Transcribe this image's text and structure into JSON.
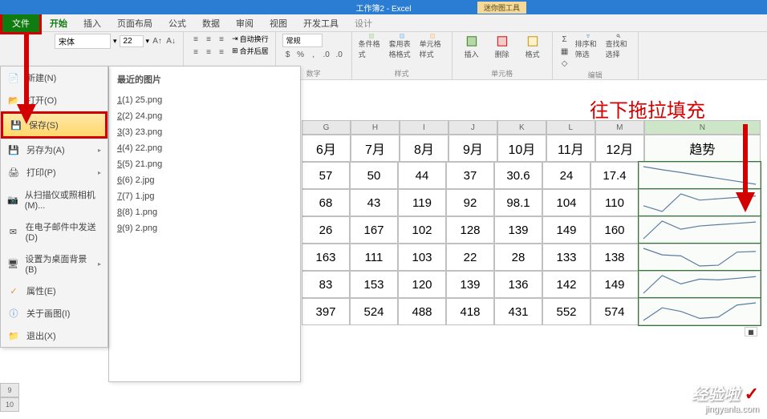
{
  "title": "工作簿2 - Excel",
  "mini_tool": "迷你图工具",
  "menu": {
    "file": "文件",
    "start": "开始",
    "insert": "插入",
    "layout": "页面布局",
    "formula": "公式",
    "data": "数据",
    "review": "审阅",
    "view": "视图",
    "dev": "开发工具",
    "design": "设计"
  },
  "ribbon": {
    "font_name": "宋体",
    "font_size": "22",
    "wrap": "自动换行",
    "merge": "合并后居",
    "num_format": "常规",
    "cond_fmt": "条件格式",
    "table_fmt": "套用表格格式",
    "cell_style": "单元格样式",
    "insert_btn": "插入",
    "delete_btn": "删除",
    "format_btn": "格式",
    "sort_filter": "排序和筛选",
    "find_select": "查找和选择",
    "group_num": "数字",
    "group_style": "样式",
    "group_cell": "单元格",
    "group_edit": "编辑"
  },
  "file_menu": {
    "new": "新建(N)",
    "open": "打开(O)",
    "save": "保存(S)",
    "saveas": "另存为(A)",
    "print": "打印(P)",
    "scan": "从扫描仪或照相机(M)...",
    "email": "在电子邮件中发送(D)",
    "bg": "设置为桌面背景(B)",
    "props": "属性(E)",
    "about": "关于画图(I)",
    "exit": "退出(X)"
  },
  "recent": {
    "title": "最近的图片",
    "items": [
      {
        "k": "1(1)",
        "v": "25.png"
      },
      {
        "k": "2(2)",
        "v": "24.png"
      },
      {
        "k": "3(3)",
        "v": "23.png"
      },
      {
        "k": "4(4)",
        "v": "22.png"
      },
      {
        "k": "5(5)",
        "v": "21.png"
      },
      {
        "k": "6(6)",
        "v": "2.jpg"
      },
      {
        "k": "7(7)",
        "v": "1.jpg"
      },
      {
        "k": "8(8)",
        "v": "1.png"
      },
      {
        "k": "9(9)",
        "v": "2.png"
      }
    ]
  },
  "red_annotation": "往下拖拉填充",
  "columns": [
    "G",
    "H",
    "I",
    "J",
    "K",
    "L",
    "M",
    "N"
  ],
  "header_row": [
    "6月",
    "7月",
    "8月",
    "9月",
    "10月",
    "11月",
    "12月",
    "趋势"
  ],
  "data_rows": [
    [
      "57",
      "50",
      "44",
      "37",
      "30.6",
      "24",
      "17.4"
    ],
    [
      "68",
      "43",
      "119",
      "92",
      "98.1",
      "104",
      "110"
    ],
    [
      "26",
      "167",
      "102",
      "128",
      "139",
      "149",
      "160"
    ],
    [
      "163",
      "111",
      "103",
      "22",
      "28",
      "133",
      "138"
    ],
    [
      "83",
      "153",
      "120",
      "139",
      "136",
      "142",
      "149"
    ],
    [
      "397",
      "524",
      "488",
      "418",
      "431",
      "552",
      "574"
    ]
  ],
  "chart_data": [
    {
      "type": "line",
      "values": [
        57,
        50,
        44,
        37,
        30.6,
        24,
        17.4
      ]
    },
    {
      "type": "line",
      "values": [
        68,
        43,
        119,
        92,
        98.1,
        104,
        110
      ]
    },
    {
      "type": "line",
      "values": [
        26,
        167,
        102,
        128,
        139,
        149,
        160
      ]
    },
    {
      "type": "line",
      "values": [
        163,
        111,
        103,
        22,
        28,
        133,
        138
      ]
    },
    {
      "type": "line",
      "values": [
        83,
        153,
        120,
        139,
        136,
        142,
        149
      ]
    },
    {
      "type": "line",
      "values": [
        397,
        524,
        488,
        418,
        431,
        552,
        574
      ]
    }
  ],
  "row_nums": [
    "9",
    "10"
  ],
  "watermark": {
    "brand": "经验啦",
    "url": "jingyanla.com"
  }
}
